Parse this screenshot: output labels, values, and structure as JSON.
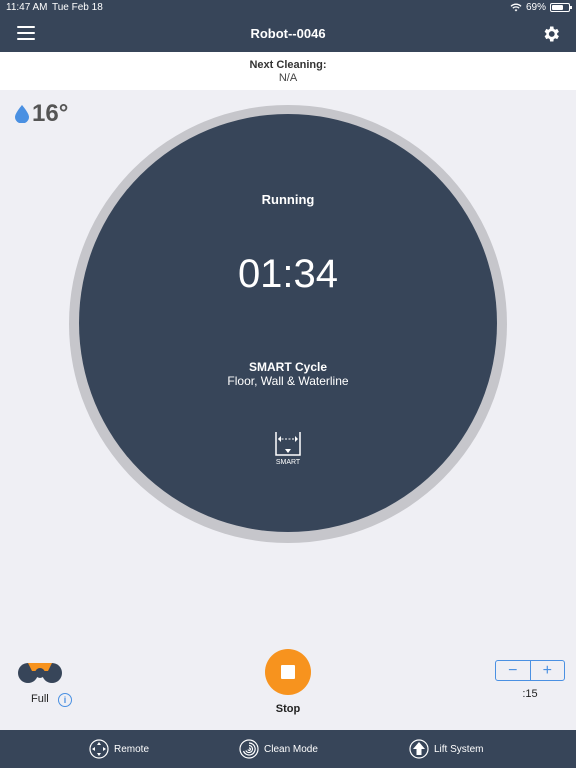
{
  "status_bar": {
    "time": "11:47 AM",
    "date": "Tue Feb 18",
    "battery": "69%"
  },
  "header": {
    "title": "Robot--0046"
  },
  "next_cleaning": {
    "label": "Next Cleaning:",
    "value": "N/A"
  },
  "temperature": {
    "value": "16°"
  },
  "dial": {
    "status": "Running",
    "time": "01:34",
    "cycle_name": "SMART Cycle",
    "cycle_desc": "Floor, Wall & Waterline",
    "icon_label": "SMART"
  },
  "filter": {
    "label": "Full"
  },
  "stop": {
    "label": "Stop"
  },
  "stepper": {
    "minus": "−",
    "plus": "+",
    "value": ":15"
  },
  "tabs": [
    {
      "label": "Remote"
    },
    {
      "label": "Clean Mode"
    },
    {
      "label": "Lift System"
    }
  ],
  "colors": {
    "primary": "#374559",
    "accent": "#f7931e",
    "link": "#4a90e2"
  }
}
